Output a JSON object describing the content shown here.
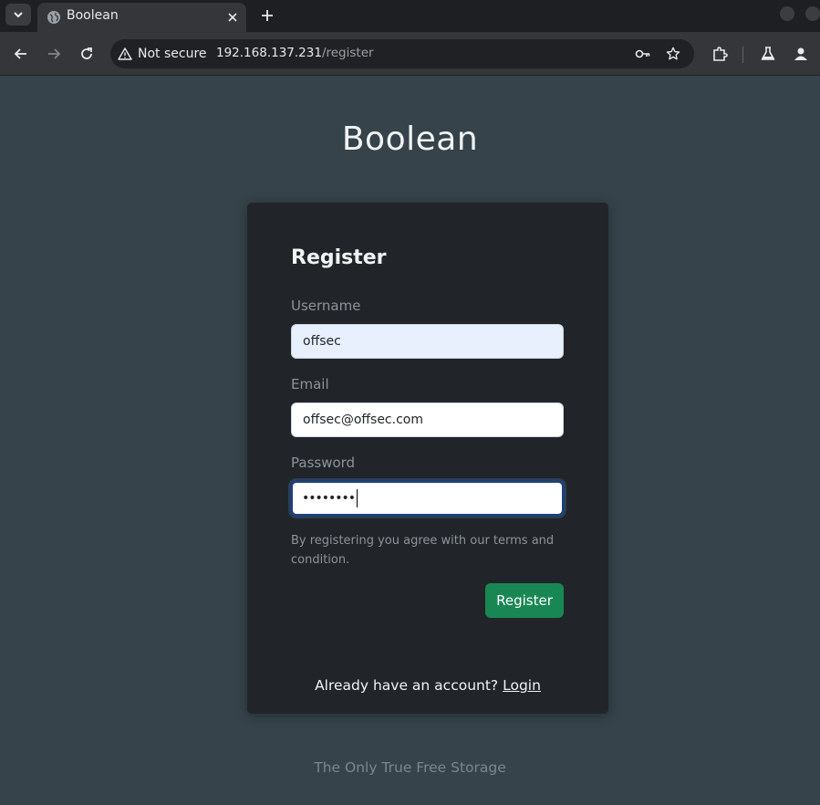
{
  "browser": {
    "tab_title": "Boolean",
    "security_label": "Not secure",
    "url_host": "192.168.137.231",
    "url_path": "/register"
  },
  "page": {
    "site_title": "Boolean",
    "footer": "The Only True Free Storage"
  },
  "form": {
    "heading": "Register",
    "username_label": "Username",
    "username_value": "offsec",
    "email_label": "Email",
    "email_value": "offsec@offsec.com",
    "password_label": "Password",
    "password_masked": "••••••••",
    "terms_text": "By registering you agree with our terms and condition.",
    "submit_label": "Register",
    "login_prompt": "Already have an account?",
    "login_link": "Login"
  },
  "icons": {
    "tab_menu": "chevron-down-icon",
    "favicon": "globe-icon",
    "tab_close": "close-icon",
    "new_tab": "plus-icon",
    "back": "arrow-left-icon",
    "forward": "arrow-right-icon",
    "reload": "reload-icon",
    "security": "warning-icon",
    "password_key": "key-icon",
    "bookmark": "star-icon",
    "extensions": "puzzle-icon",
    "labs": "flask-icon",
    "profile": "person-icon"
  },
  "colors": {
    "page_bg": "#36434a",
    "card_bg": "#212529",
    "button_bg": "#198754"
  }
}
